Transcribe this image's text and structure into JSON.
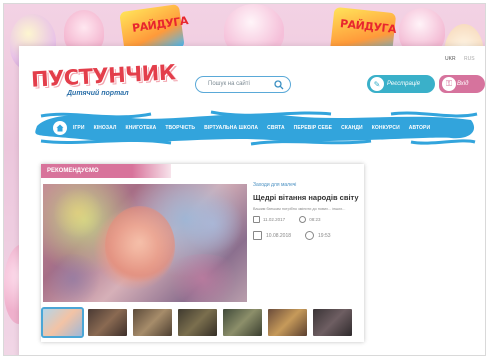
{
  "background": {
    "pack_text": "РАЙДУГА"
  },
  "lang": {
    "ukr": "UKR",
    "rus": "RUS"
  },
  "brand": {
    "logo": "ПУСТУНЧИК",
    "tagline": "Дитячий портал"
  },
  "search": {
    "placeholder": "Пошук на сайті"
  },
  "auth": {
    "register": "Реєстрація",
    "login": "Вхід"
  },
  "nav": {
    "items": [
      "ігри",
      "кінозал",
      "книготека",
      "творчість",
      "віртуальна школа",
      "свята",
      "перевір себе",
      "сканди",
      "конкурси",
      "автори"
    ]
  },
  "recommend": {
    "header": "РЕКОМЕНДУЄМО",
    "category": "Заходи для малечі",
    "title": "Щедрі вітання народів світу",
    "description": "Вашим батькам потрібно змінити до нових... інших...",
    "date1": "11.02.2017",
    "time1": "08:23",
    "date2": "10.08.2018",
    "time2": "19:53"
  },
  "colors": {
    "nav_blue": "#32a4dc",
    "accent_pink": "#d8739b",
    "register_teal": "#3ab0c9"
  }
}
